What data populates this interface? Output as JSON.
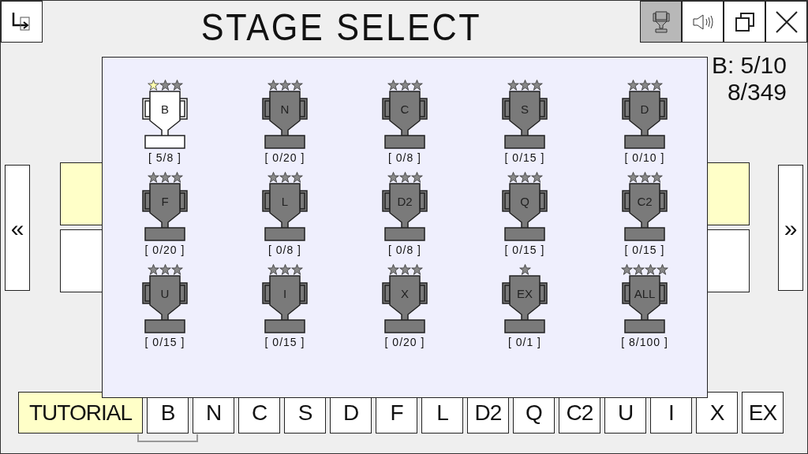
{
  "title": "STAGE SELECT",
  "top_buttons": [
    {
      "kind": "trophy",
      "selected": true
    },
    {
      "kind": "sound",
      "selected": false
    },
    {
      "kind": "window",
      "selected": false
    },
    {
      "kind": "close",
      "selected": false
    }
  ],
  "stats": [
    "B: 5/10",
    "8/349"
  ],
  "nav": {
    "prev": "«",
    "next": "»"
  },
  "trophies": [
    {
      "label": "B",
      "unlocked": true,
      "progress": "[ 5/8 ]",
      "star_slots": [
        {
          "filled": true
        },
        {
          "filled": false
        },
        {
          "filled": false
        }
      ]
    },
    {
      "label": "N",
      "unlocked": false,
      "progress": "[ 0/20 ]",
      "star_slots": [
        {
          "filled": false
        },
        {
          "filled": false
        },
        {
          "filled": false
        }
      ]
    },
    {
      "label": "C",
      "unlocked": false,
      "progress": "[ 0/8 ]",
      "star_slots": [
        {
          "filled": false
        },
        {
          "filled": false
        },
        {
          "filled": false
        }
      ]
    },
    {
      "label": "S",
      "unlocked": false,
      "progress": "[ 0/15 ]",
      "star_slots": [
        {
          "filled": false
        },
        {
          "filled": false
        },
        {
          "filled": false
        }
      ]
    },
    {
      "label": "D",
      "unlocked": false,
      "progress": "[ 0/10 ]",
      "star_slots": [
        {
          "filled": false
        },
        {
          "filled": false
        },
        {
          "filled": false
        }
      ]
    },
    {
      "label": "F",
      "unlocked": false,
      "progress": "[ 0/20 ]",
      "star_slots": [
        {
          "filled": false
        },
        {
          "filled": false
        },
        {
          "filled": false
        }
      ]
    },
    {
      "label": "L",
      "unlocked": false,
      "progress": "[ 0/8 ]",
      "star_slots": [
        {
          "filled": false
        },
        {
          "filled": false
        },
        {
          "filled": false
        }
      ]
    },
    {
      "label": "D2",
      "unlocked": false,
      "progress": "[ 0/8 ]",
      "star_slots": [
        {
          "filled": false
        },
        {
          "filled": false
        },
        {
          "filled": false
        }
      ]
    },
    {
      "label": "Q",
      "unlocked": false,
      "progress": "[ 0/15 ]",
      "star_slots": [
        {
          "filled": false
        },
        {
          "filled": false
        },
        {
          "filled": false
        }
      ]
    },
    {
      "label": "C2",
      "unlocked": false,
      "progress": "[ 0/15 ]",
      "star_slots": [
        {
          "filled": false
        },
        {
          "filled": false
        },
        {
          "filled": false
        }
      ]
    },
    {
      "label": "U",
      "unlocked": false,
      "progress": "[ 0/15 ]",
      "star_slots": [
        {
          "filled": false
        },
        {
          "filled": false
        },
        {
          "filled": false
        }
      ]
    },
    {
      "label": "I",
      "unlocked": false,
      "progress": "[ 0/15 ]",
      "star_slots": [
        {
          "filled": false
        },
        {
          "filled": false
        },
        {
          "filled": false
        }
      ]
    },
    {
      "label": "X",
      "unlocked": false,
      "progress": "[ 0/20 ]",
      "star_slots": [
        {
          "filled": false
        },
        {
          "filled": false
        },
        {
          "filled": false
        }
      ]
    },
    {
      "label": "EX",
      "unlocked": false,
      "progress": "[ 0/1 ]",
      "star_slots": [
        {
          "filled": false
        }
      ]
    },
    {
      "label": "ALL",
      "unlocked": false,
      "progress": "[ 8/100 ]",
      "star_slots": [
        {
          "filled": false
        },
        {
          "filled": false
        },
        {
          "filled": false
        },
        {
          "filled": false
        }
      ]
    }
  ],
  "tabs": [
    {
      "label": "TUTORIAL",
      "selected": true,
      "focused": false
    },
    {
      "label": "B",
      "selected": false,
      "focused": true
    },
    {
      "label": "N",
      "selected": false,
      "focused": false
    },
    {
      "label": "C",
      "selected": false,
      "focused": false
    },
    {
      "label": "S",
      "selected": false,
      "focused": false
    },
    {
      "label": "D",
      "selected": false,
      "focused": false
    },
    {
      "label": "F",
      "selected": false,
      "focused": false
    },
    {
      "label": "L",
      "selected": false,
      "focused": false
    },
    {
      "label": "D2",
      "selected": false,
      "focused": false
    },
    {
      "label": "Q",
      "selected": false,
      "focused": false
    },
    {
      "label": "C2",
      "selected": false,
      "focused": false
    },
    {
      "label": "U",
      "selected": false,
      "focused": false
    },
    {
      "label": "I",
      "selected": false,
      "focused": false
    },
    {
      "label": "X",
      "selected": false,
      "focused": false
    },
    {
      "label": "EX",
      "selected": false,
      "focused": false
    }
  ]
}
